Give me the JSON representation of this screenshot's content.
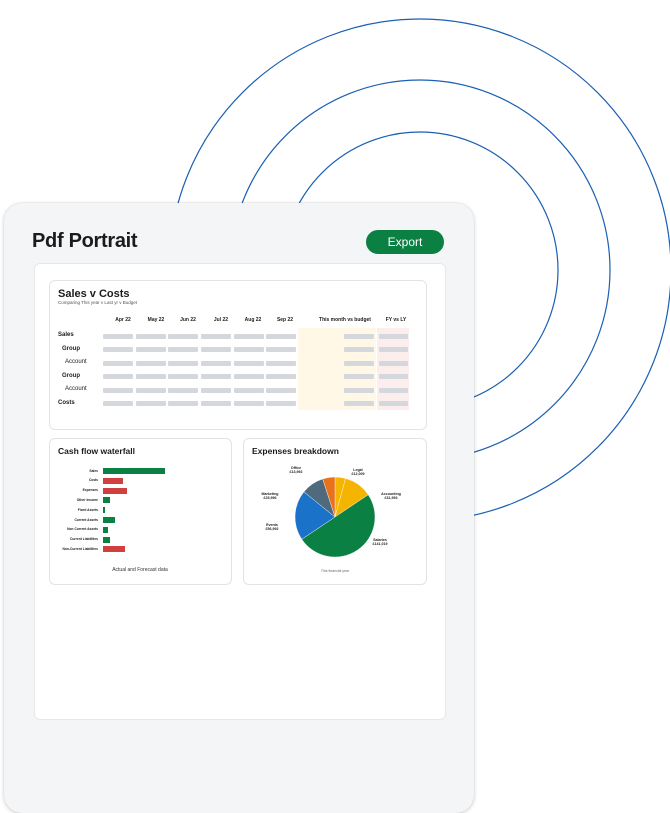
{
  "page": {
    "title": "Pdf Portrait",
    "export_label": "Export",
    "ring_color": "#1a5fb4",
    "accent": "#0b8043"
  },
  "sales_costs": {
    "title": "Sales v Costs",
    "subtitle": "Comparing This year v Last yr v Budget",
    "columns": [
      "Apr 22",
      "May 22",
      "Jun 22",
      "Jul 22",
      "Aug 22",
      "Sep 22",
      "This month vs budget",
      "FY vs LY"
    ],
    "rows": [
      {
        "label": "Sales",
        "level": 0
      },
      {
        "label": "Group",
        "level": 1
      },
      {
        "label": "Account",
        "level": 2
      },
      {
        "label": "Group",
        "level": 1
      },
      {
        "label": "Account",
        "level": 2
      },
      {
        "label": "Costs",
        "level": 0
      }
    ]
  },
  "cash_flow": {
    "title": "Cash flow waterfall",
    "caption": "Actual and Forecast data",
    "chart_data": {
      "type": "bar",
      "categories": [
        "Sales",
        "Costs",
        "Expenses",
        "Other Income",
        "Fixed Assets",
        "Current Assets",
        "Non Current Assets",
        "Current Liabilities",
        "Non-Current Liabilities"
      ],
      "values": [
        62,
        -20,
        -24,
        7,
        2,
        12,
        5,
        7,
        -22
      ],
      "colors": {
        "positive": "#0b8043",
        "negative": "#d0403e"
      }
    }
  },
  "expenses": {
    "title": "Expenses breakdown",
    "caption": "This financial year",
    "chart_data": {
      "type": "pie",
      "slices": [
        {
          "name": "Legal",
          "label": "Legal",
          "value_label": "£12,009",
          "value": 12009,
          "color": "#f5b400"
        },
        {
          "name": "Accounting",
          "label": "Accounting",
          "value_label": "£31,993",
          "value": 31993,
          "color": "#f5b400"
        },
        {
          "name": "Salaries",
          "label": "Salaries",
          "value_label": "£141,019",
          "value": 141019,
          "color": "#0b8043"
        },
        {
          "name": "Events",
          "label": "Events",
          "value_label": "£56,992",
          "value": 56992,
          "color": "#1a73c8"
        },
        {
          "name": "Marketing",
          "label": "Marketing",
          "value_label": "£25,996",
          "value": 25996,
          "color": "#4f6a7c"
        },
        {
          "name": "Office",
          "label": "Office",
          "value_label": "£13,992",
          "value": 13992,
          "color": "#e8711c"
        }
      ]
    }
  }
}
